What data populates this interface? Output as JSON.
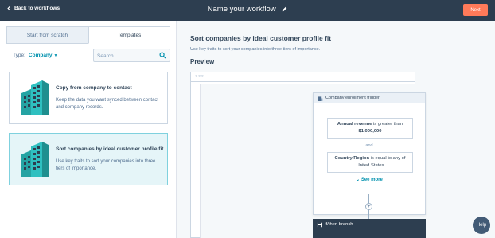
{
  "topbar": {
    "back_label": "Back to workflows",
    "workflow_name": "Name your workflow",
    "next_label": "Next"
  },
  "tabs": [
    {
      "label": "Start from scratch",
      "active": false
    },
    {
      "label": "Templates",
      "active": true
    }
  ],
  "filter": {
    "type_label": "Type:",
    "type_value": "Company",
    "search_placeholder": "Search"
  },
  "cards": [
    {
      "title": "Copy from company to contact",
      "description": "Keep the data you want synced between contact and company records.",
      "selected": false
    },
    {
      "title": "Sort companies by ideal customer profile fit",
      "description": "Use key traits to sort your companies into three tiers of importance.",
      "selected": true
    }
  ],
  "detail": {
    "title": "Sort companies by ideal customer profile fit",
    "description": "Use key traits to sort your companies into three tiers of importance.",
    "preview_label": "Preview",
    "trigger": {
      "header": "Company enrollment trigger",
      "condition1_bold": "Annual revenue",
      "condition1_rest": " is greater than",
      "condition1_value": "$1,000,000",
      "and_label": "and",
      "condition2_bold": "Country/Region",
      "condition2_rest": " is equal to any of",
      "condition2_value": "United States",
      "see_more": "See more"
    },
    "branch_label": "If/then branch"
  },
  "help_label": "Help",
  "colors": {
    "topbar": "#2d3e50",
    "accent": "#ff7a59",
    "link": "#0091ae",
    "selected_card": "#e5f5f8"
  }
}
